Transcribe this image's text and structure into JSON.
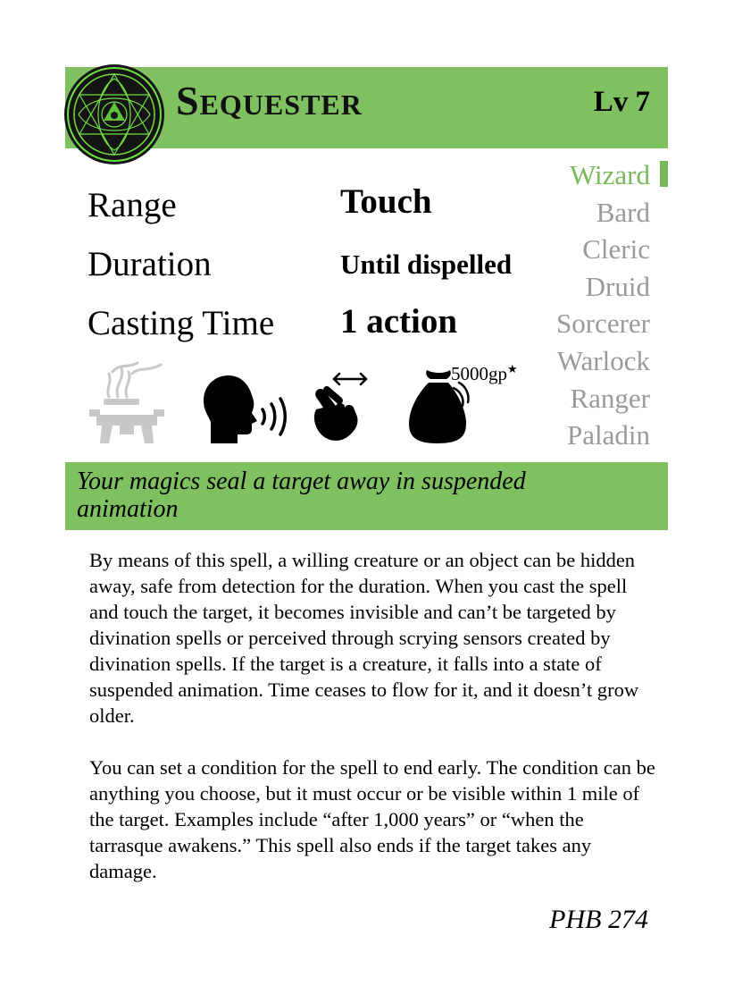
{
  "card": {
    "name": "Sequester",
    "level": "Lv 7",
    "range_label": "Range",
    "range_value": "Touch",
    "duration_label": "Duration",
    "duration_value": "Until dispelled",
    "casting_label": "Casting Time",
    "casting_value": "1 action",
    "material_cost": "5000gp",
    "material_mark": "★",
    "tagline": "Your magics seal a target away in suspended animation",
    "paragraphs": [
      "By means of this spell, a willing creature or an object can be hidden away, safe from detection for the duration. When you cast the spell and touch the target, it becomes invisible and can’t be targeted by divination spells or perceived through scrying sensors created by divination spells. If the target is a creature, it falls into a state of suspended animation. Time ceases to flow for it, and it doesn’t grow older.",
      "You can set a condition for the spell to end early. The condition can be anything you choose, but it must occur or be visible within 1 mile of the target. Examples include “after 1,000 years” or “when the tarrasque awakens.” This spell also ends if the target takes any damage."
    ],
    "source": "PHB 274"
  },
  "classes": [
    {
      "name": "Wizard",
      "active": true
    },
    {
      "name": "Bard",
      "active": false
    },
    {
      "name": "Cleric",
      "active": false
    },
    {
      "name": "Druid",
      "active": false
    },
    {
      "name": "Sorcerer",
      "active": false
    },
    {
      "name": "Warlock",
      "active": false
    },
    {
      "name": "Ranger",
      "active": false
    },
    {
      "name": "Paladin",
      "active": false
    }
  ],
  "icons": [
    "ritual-incense-icon",
    "verbal-speaking-head-icon",
    "somatic-hand-icon",
    "material-pouch-icon",
    "school-seal-icon"
  ],
  "colors": {
    "accent": "#7fc060",
    "active_class": "#79b85a",
    "inactive_class": "#9a9a9a",
    "seal_glow": "#6fe040"
  }
}
